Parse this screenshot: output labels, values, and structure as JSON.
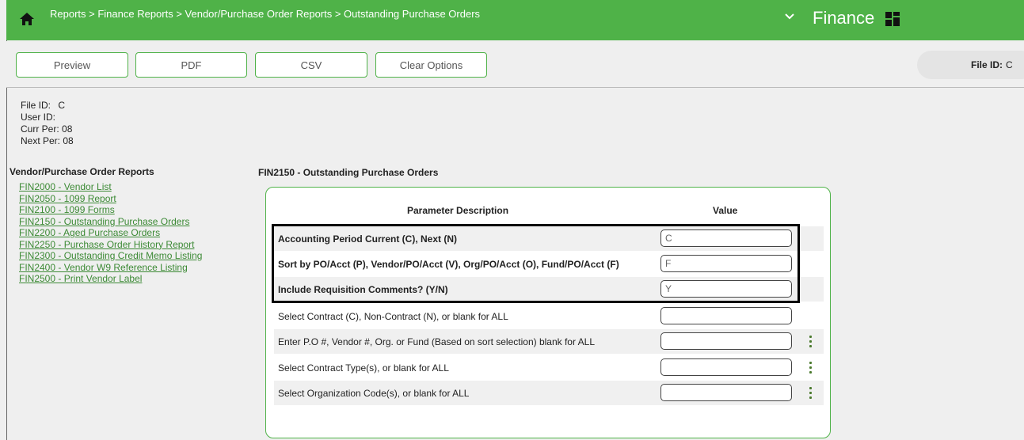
{
  "header": {
    "breadcrumb": "Reports > Finance Reports > Vendor/Purchase Order Reports > Outstanding Purchase Orders",
    "app_name": "Finance"
  },
  "toolbar": {
    "preview": "Preview",
    "pdf": "PDF",
    "csv": "CSV",
    "clear": "Clear Options",
    "file_id_label": "File ID:",
    "file_id_value": "C"
  },
  "info": [
    {
      "label": "File ID:",
      "value": "C"
    },
    {
      "label": "User ID:",
      "value": ""
    },
    {
      "label": "Curr Per:",
      "value": "08"
    },
    {
      "label": "Next Per:",
      "value": "08"
    }
  ],
  "nav": {
    "title": "Vendor/Purchase Order Reports",
    "items": [
      "FIN2000 - Vendor List",
      "FIN2050 - 1099 Report",
      "FIN2100 - 1099 Forms",
      "FIN2150 - Outstanding Purchase Orders",
      "FIN2200 - Aged Purchase Orders",
      "FIN2250 - Purchase Order History Report",
      "FIN2300 - Outstanding Credit Memo Listing",
      "FIN2400 - Vendor W9 Reference Listing",
      "FIN2500 - Print Vendor Label"
    ]
  },
  "form": {
    "title": "FIN2150 - Outstanding Purchase Orders",
    "col_desc": "Parameter Description",
    "col_value": "Value",
    "params": [
      {
        "desc": "Accounting Period Current (C), Next (N)",
        "value": "C"
      },
      {
        "desc": "Sort by PO/Acct (P), Vendor/PO/Acct (V), Org/PO/Acct (O), Fund/PO/Acct (F)",
        "value": "F"
      },
      {
        "desc": "Include Requisition Comments? (Y/N)",
        "value": "Y"
      },
      {
        "desc": "Select Contract (C), Non-Contract (N), or blank for ALL",
        "value": ""
      },
      {
        "desc": "Enter P.O #, Vendor #, Org. or Fund (Based on sort selection) blank for ALL",
        "value": ""
      },
      {
        "desc": "Select Contract Type(s), or blank for ALL",
        "value": ""
      },
      {
        "desc": "Select Organization Code(s), or blank for ALL",
        "value": ""
      }
    ]
  },
  "colors": {
    "brand_green": "#4fb248",
    "link_green": "#3c8a35"
  },
  "icons": [
    "home-icon",
    "chevron-down-icon",
    "app-grid-icon",
    "more-vertical-icon"
  ]
}
